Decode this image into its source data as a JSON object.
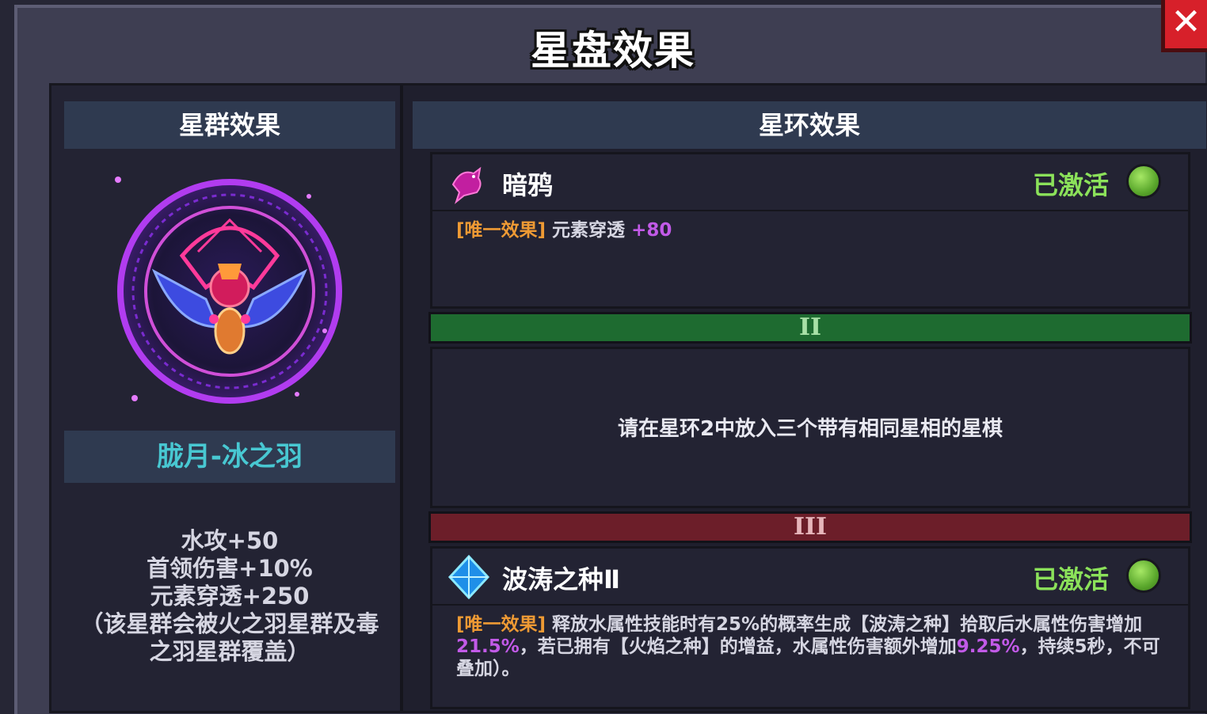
{
  "dialog": {
    "title": "星盘效果",
    "close_icon": "close-icon"
  },
  "cluster": {
    "header": "星群效果",
    "name": "胧月-冰之羽",
    "stats": [
      "水攻+50",
      "首领伤害+10%",
      "元素穿透+250",
      "（该星群会被火之羽星群及毒",
      "之羽星群覆盖）"
    ]
  },
  "rings": {
    "header": "星环效果",
    "ring1": {
      "name": "暗鸦",
      "status": "已激活",
      "tag": "[唯一效果]",
      "desc_text": "元素穿透",
      "desc_value": "+80",
      "icon": "crow-icon"
    },
    "tier2": {
      "numeral": "II",
      "hint": "请在星环2中放入三个带有相同星相的星棋"
    },
    "tier3": {
      "numeral": "III",
      "name": "波涛之种Ⅱ",
      "status": "已激活",
      "icon": "crystal-icon",
      "tag": "[唯一效果]",
      "desc_part1": "释放水属性技能时有25%的概率生成【波涛之种】拾取后水属性伤害增加",
      "desc_val1": "21.5%",
      "desc_part2": "，若已拥有【火焰之种】的增益，水属性伤害额外增加",
      "desc_val2": "9.25%",
      "desc_part3": "，持续5秒，不可叠加）。"
    }
  },
  "colors": {
    "active_green": "#8be15a",
    "unique_tag": "#ee9a34",
    "value_purple": "#c25ae8",
    "cluster_name": "#48c8d2"
  }
}
